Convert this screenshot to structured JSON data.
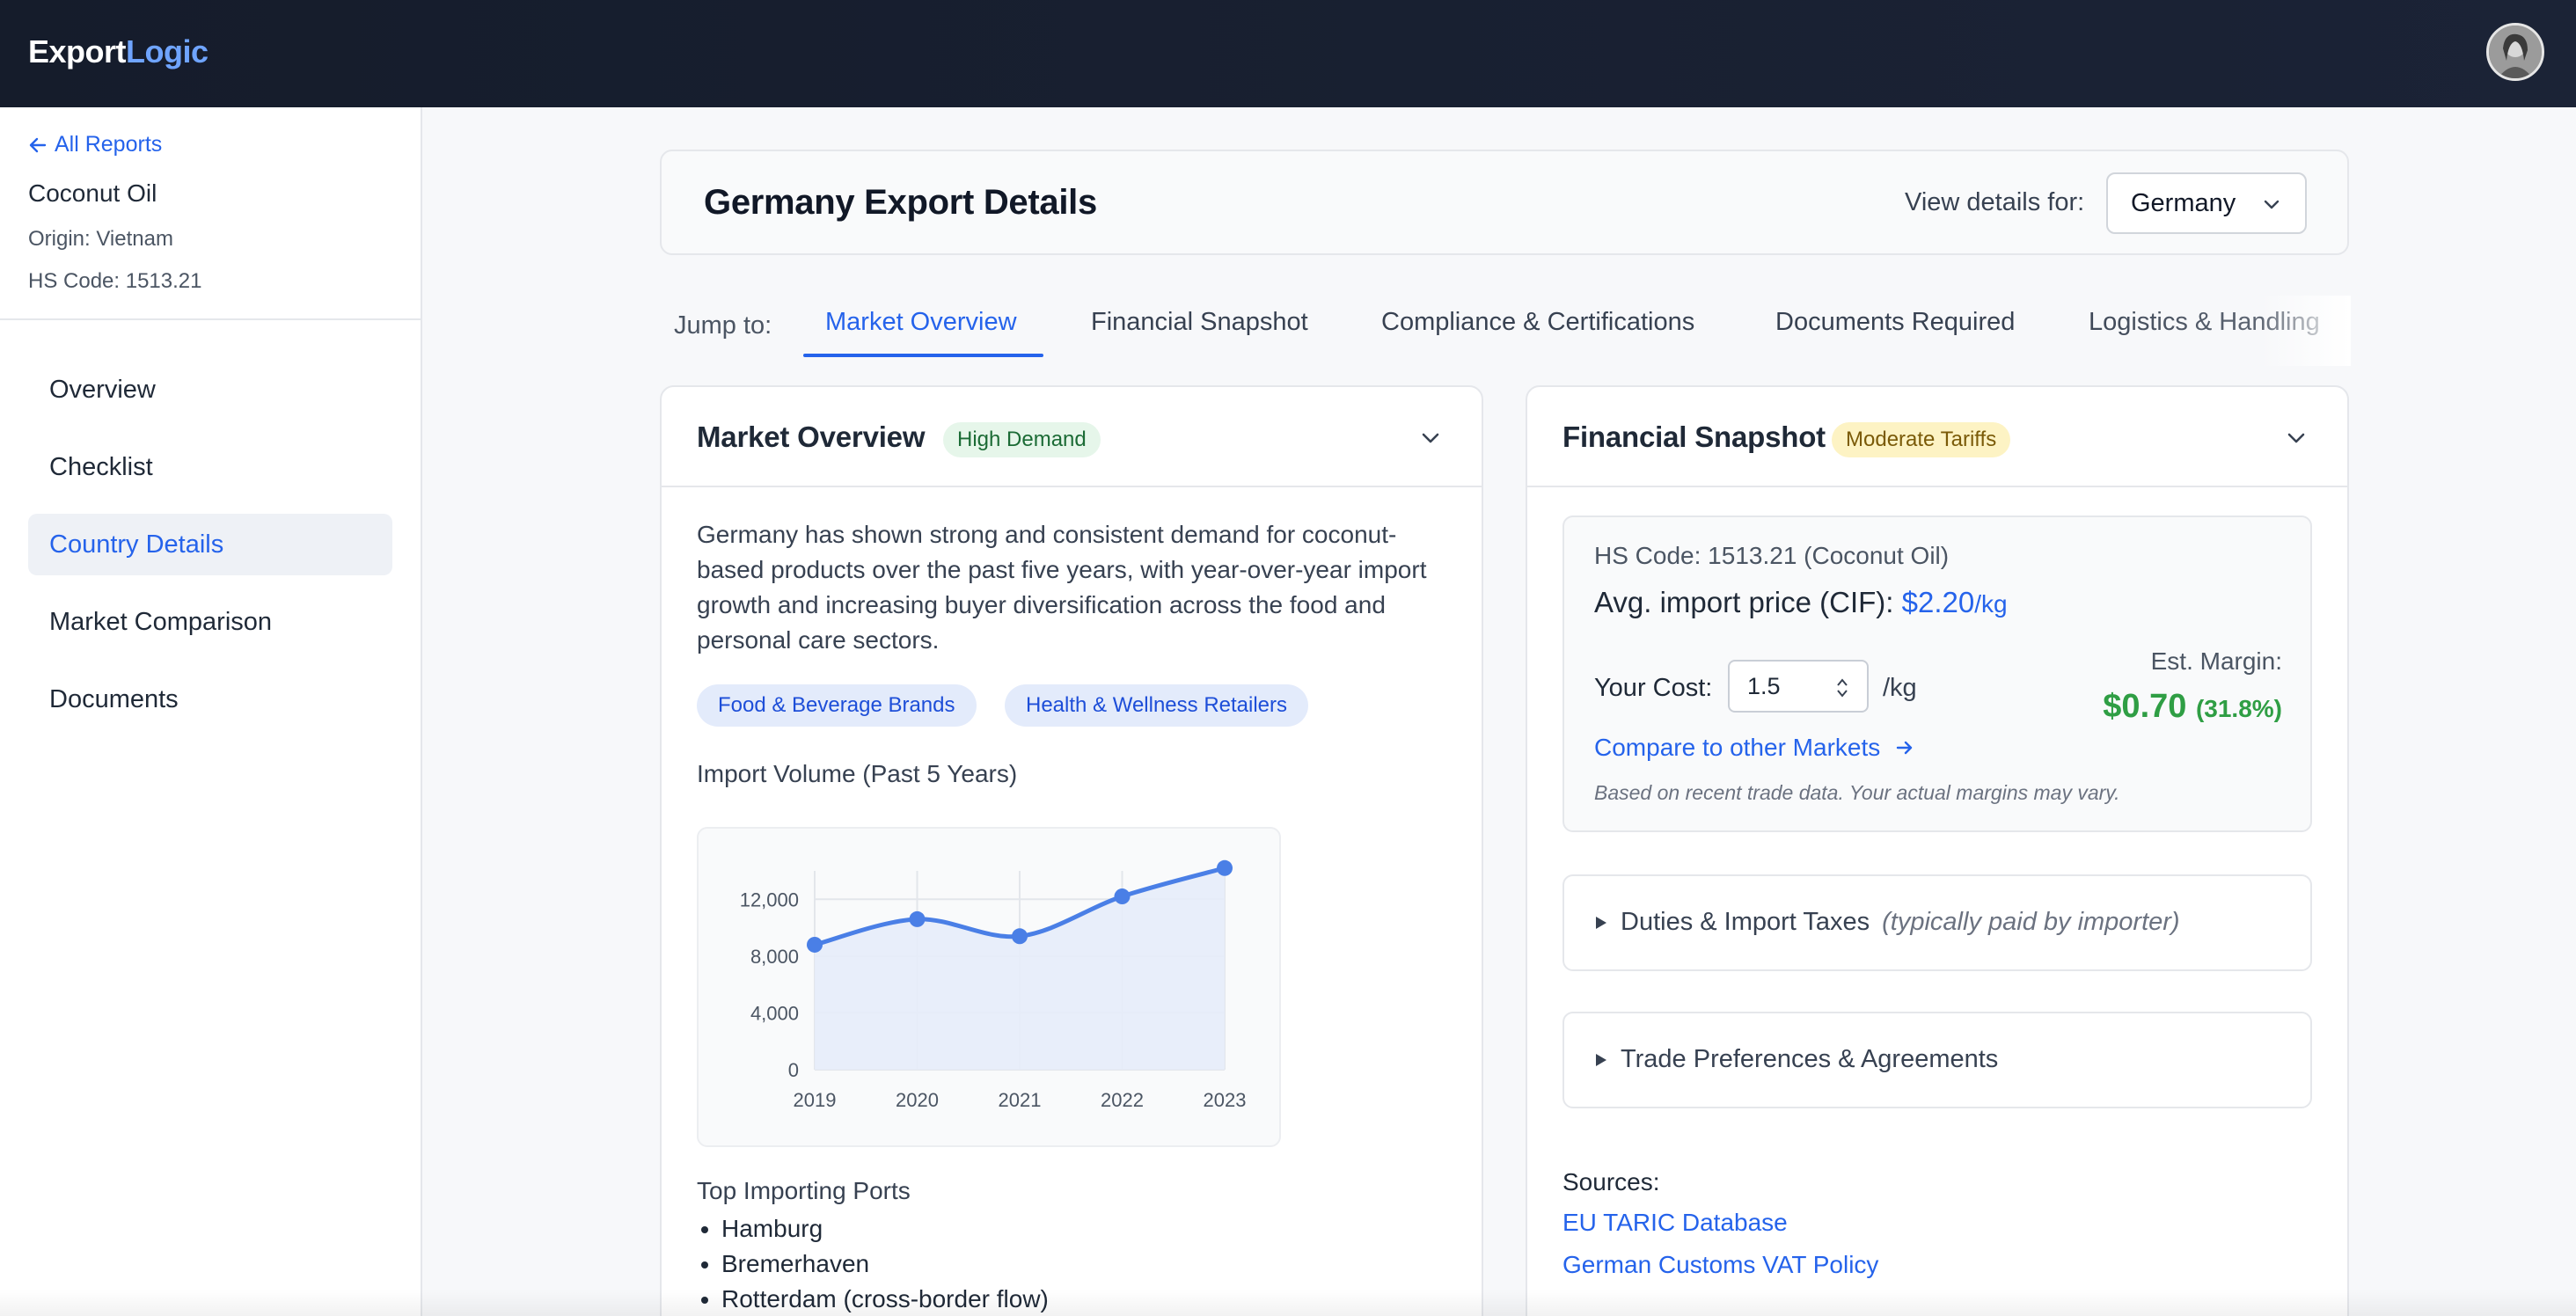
{
  "app": {
    "logo_main": "Export",
    "logo_accent": "Logic"
  },
  "sidebar": {
    "back_label": "All Reports",
    "product": "Coconut Oil",
    "origin": "Origin: Vietnam",
    "hs_code": "HS Code: 1513.21",
    "items": [
      {
        "label": "Overview",
        "active": false
      },
      {
        "label": "Checklist",
        "active": false
      },
      {
        "label": "Country Details",
        "active": true
      },
      {
        "label": "Market Comparison",
        "active": false
      },
      {
        "label": "Documents",
        "active": false
      }
    ]
  },
  "header": {
    "title": "Germany Export Details",
    "view_label": "View details for:",
    "country": "Germany"
  },
  "jump": {
    "label": "Jump to:",
    "tabs": [
      {
        "label": "Market Overview",
        "active": true
      },
      {
        "label": "Financial Snapshot",
        "active": false
      },
      {
        "label": "Compliance & Certifications",
        "active": false
      },
      {
        "label": "Documents Required",
        "active": false
      },
      {
        "label": "Logistics & Handling",
        "active": false
      }
    ]
  },
  "market": {
    "title": "Market Overview",
    "badge": "High Demand",
    "description": "Germany has shown strong and consistent demand for coconut-based products over the past five years, with year-over-year import growth and increasing buyer diversification across the food and personal care sectors.",
    "pills": [
      "Food & Beverage Brands",
      "Health & Wellness Retailers"
    ],
    "chart_title": "Import Volume (Past 5 Years)",
    "ports_title": "Top Importing Ports",
    "ports": [
      "Hamburg",
      "Bremerhaven",
      "Rotterdam (cross-border flow)"
    ]
  },
  "chart_data": {
    "type": "area",
    "categories": [
      "2019",
      "2020",
      "2021",
      "2022",
      "2023"
    ],
    "values": [
      8800,
      10600,
      9400,
      12200,
      14200
    ],
    "title": "Import Volume (Past 5 Years)",
    "xlabel": "",
    "ylabel": "",
    "ylim": [
      0,
      14000
    ],
    "yticks": [
      "0",
      "4,000",
      "8,000",
      "12,000"
    ],
    "grid": true,
    "line_color": "#4a7fe6",
    "fill_color": "#e6ecf9"
  },
  "financial": {
    "title": "Financial Snapshot",
    "badge": "Moderate Tariffs",
    "hs_line": "HS Code: 1513.21 (Coconut Oil)",
    "price_label": "Avg. import price (CIF):",
    "price_value": "$2.20",
    "price_unit": "/kg",
    "cost_label": "Your Cost:",
    "cost_value": "1.5",
    "cost_unit": "/kg",
    "margin_label": "Est. Margin:",
    "margin_value": "$0.70",
    "margin_pct": "(31.8%)",
    "compare_label": "Compare to other Markets",
    "disclaimer": "Based on recent trade data. Your actual margins may vary.",
    "duties_label": "Duties & Import Taxes",
    "duties_note": "(typically paid by importer)",
    "trade_label": "Trade Preferences & Agreements",
    "sources_label": "Sources:",
    "sources": [
      "EU TARIC Database",
      "German Customs VAT Policy"
    ]
  },
  "colors": {
    "accent": "#2563eb",
    "topbar": "#151c2b",
    "margin_green": "#2f9e44",
    "badge_green_bg": "#e6f6ea",
    "badge_yellow_bg": "#fdf3c4"
  },
  "icons": {
    "back": "arrow-left-icon",
    "select": "chevron-down-icon",
    "collapse": "chevron-down-icon",
    "compare": "arrow-right-icon",
    "accordion": "triangle-right-icon",
    "spinner": "stepper-icon"
  }
}
